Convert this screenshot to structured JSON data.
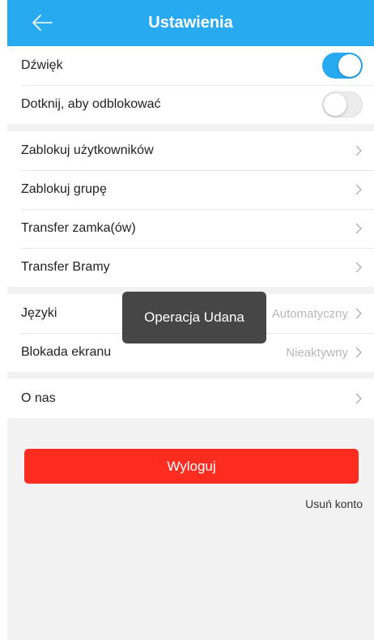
{
  "header": {
    "title": "Ustawienia",
    "back_icon": "arrow-left-icon"
  },
  "colors": {
    "accent": "#27aaf0",
    "danger": "#fc2c20",
    "background": "#f2f2f2"
  },
  "toggles": [
    {
      "label": "Dźwięk",
      "on": true
    },
    {
      "label": "Dotknij, aby odblokować",
      "on": false
    }
  ],
  "management": [
    {
      "label": "Zablokuj użytkowników"
    },
    {
      "label": "Zablokuj grupę"
    },
    {
      "label": "Transfer zamka(ów)"
    },
    {
      "label": "Transfer Bramy"
    }
  ],
  "preferences": [
    {
      "label": "Języki",
      "value": "Automatyczny"
    },
    {
      "label": "Blokada ekranu",
      "value": "Nieaktywny"
    }
  ],
  "about": {
    "label": "O nas"
  },
  "logout_label": "Wyloguj",
  "delete_account_label": "Usuń konto",
  "toast": {
    "message": "Operacja Udana"
  }
}
